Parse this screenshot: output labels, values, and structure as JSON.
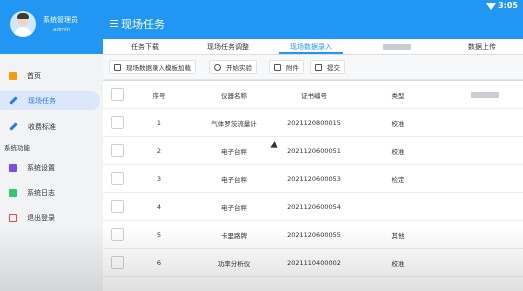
{
  "status": {
    "time": "3:05"
  },
  "user": {
    "name": "系统管理员",
    "account": "admin"
  },
  "header": {
    "title": "现场任务"
  },
  "sidebar": {
    "items": [
      {
        "label": "首页",
        "icon": "file-icon",
        "color": "#f39c12"
      },
      {
        "label": "现场任务",
        "icon": "pen-icon",
        "color": "#2b79e5",
        "active": true
      },
      {
        "label": "收费标准",
        "icon": "pen-icon",
        "color": "#2b79e5"
      }
    ],
    "section_title": "系统功能",
    "system_items": [
      {
        "label": "系统设置",
        "icon": "settings-icon",
        "color": "#7b4de0"
      },
      {
        "label": "系统日志",
        "icon": "log-icon",
        "color": "#2ecc71"
      },
      {
        "label": "退出登录",
        "icon": "logout-icon",
        "color": "#e74c3c"
      }
    ]
  },
  "tabs": [
    {
      "label": "任务下载"
    },
    {
      "label": "现场任务调整"
    },
    {
      "label": "现场数据录入",
      "active": true
    },
    {
      "label": ""
    },
    {
      "label": "数据上传"
    }
  ],
  "toolbar": {
    "template_label": "现场数据录入模板加载",
    "start_label": "开始实验",
    "attach_label": "附件",
    "submit_label": "提交"
  },
  "table": {
    "columns": [
      "序号",
      "仪器名称",
      "证书编号",
      "类型",
      ""
    ],
    "rows": [
      {
        "no": "1",
        "name": "气体罗茨流量计",
        "cert": "2021120800015",
        "type": "校准"
      },
      {
        "no": "2",
        "name": "电子台秤",
        "cert": "2021120600051",
        "type": "校准"
      },
      {
        "no": "3",
        "name": "电子台秤",
        "cert": "2021120600053",
        "type": "检定"
      },
      {
        "no": "4",
        "name": "电子台秤",
        "cert": "2021120600054",
        "type": ""
      },
      {
        "no": "5",
        "name": "卡里路牌",
        "cert": "2021120600055",
        "type": "其他"
      },
      {
        "no": "6",
        "name": "功率分析仪",
        "cert": "2021110400002",
        "type": "校准"
      }
    ]
  },
  "colors": {
    "primary": "#2196f3",
    "active_nav_bg": "#dbe7fb"
  }
}
